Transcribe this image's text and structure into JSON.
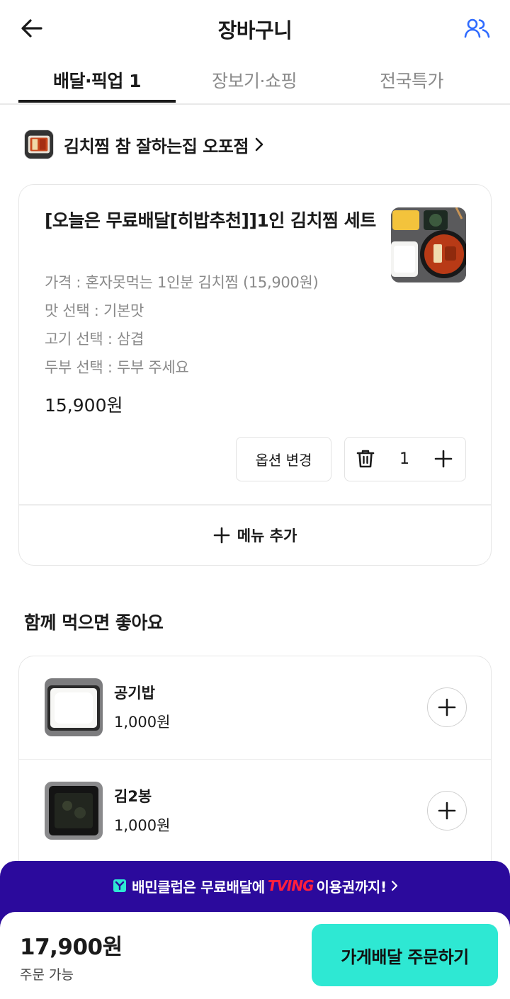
{
  "header": {
    "title": "장바구니",
    "back_icon": "arrow-left-icon",
    "share_icon": "people-icon"
  },
  "tabs": [
    {
      "label": "배달·픽업 1",
      "active": true
    },
    {
      "label": "장보기·쇼핑",
      "active": false
    },
    {
      "label": "전국특가",
      "active": false
    }
  ],
  "store": {
    "name": "김치찜 참 잘하는집 오포점"
  },
  "cart_item": {
    "name": "[오늘은 무료배달[히밥추천]]1인 김치찜 세트",
    "options": [
      "가격 : 혼자못먹는 1인분 김치찜 (15,900원)",
      "맛 선택 : 기본맛",
      "고기 선택 : 삼겹",
      "두부 선택 : 두부 주세요"
    ],
    "price": "15,900원",
    "quantity": "1",
    "option_change_label": "옵션 변경",
    "add_menu_label": "메뉴 추가"
  },
  "recommendations": {
    "title": "함께 먹으면 좋아요",
    "items": [
      {
        "name": "공기밥",
        "price": "1,000원"
      },
      {
        "name": "김2봉",
        "price": "1,000원"
      }
    ]
  },
  "promo": {
    "text_before": "배민클럽은 무료배달에",
    "brand": "TVING",
    "text_after": "이용권까지!"
  },
  "bottom": {
    "total": "17,900원",
    "status": "주문 가능",
    "order_button": "가게배달 주문하기"
  },
  "colors": {
    "accent_mint": "#2ee8d3",
    "promo_purple": "#2b0a9c",
    "brand_red": "#ff1f3d",
    "icon_blue": "#2f6bff"
  }
}
